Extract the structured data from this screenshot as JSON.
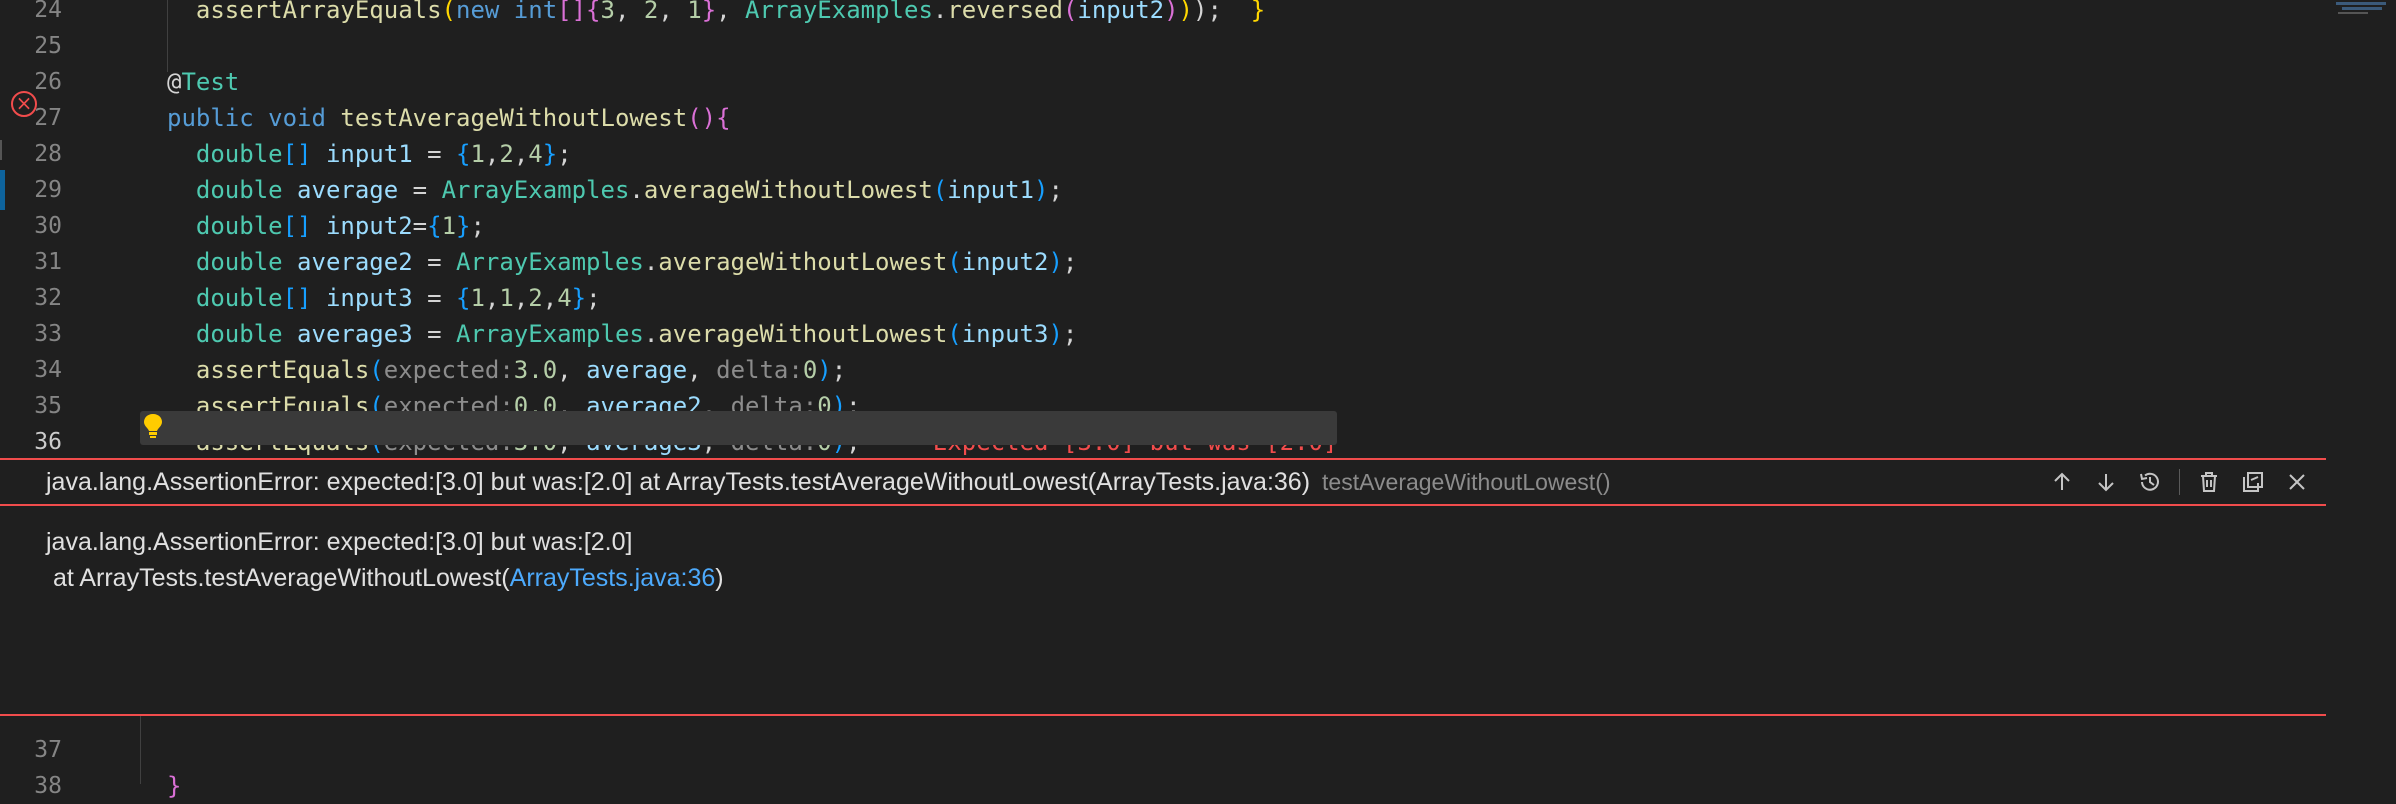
{
  "editor": {
    "lines": [
      {
        "num": "24",
        "tokens": [
          {
            "t": "  ",
            "c": "txt"
          },
          {
            "t": "assertArrayEquals",
            "c": "fn"
          },
          {
            "t": "(",
            "c": "p1"
          },
          {
            "t": "new ",
            "c": "kw"
          },
          {
            "t": "int",
            "c": "kw"
          },
          {
            "t": "[]{",
            "c": "p2"
          },
          {
            "t": "3",
            "c": "num"
          },
          {
            "t": ", ",
            "c": "txt"
          },
          {
            "t": "2",
            "c": "num"
          },
          {
            "t": ", ",
            "c": "txt"
          },
          {
            "t": "1",
            "c": "num"
          },
          {
            "t": "}",
            "c": "p2"
          },
          {
            "t": ", ",
            "c": "txt"
          },
          {
            "t": "ArrayExamples",
            "c": "typ"
          },
          {
            "t": ".",
            "c": "txt"
          },
          {
            "t": "reversed",
            "c": "fn"
          },
          {
            "t": "(",
            "c": "p2"
          },
          {
            "t": "input2",
            "c": "var"
          },
          {
            "t": ")",
            "c": "p2"
          },
          {
            "t": ")",
            "c": "p1"
          },
          {
            "t": ");  ",
            "c": "txt"
          },
          {
            "t": "}",
            "c": "p1"
          }
        ]
      },
      {
        "num": "25",
        "tokens": []
      },
      {
        "num": "26",
        "tokens": [
          {
            "t": "@",
            "c": "txt"
          },
          {
            "t": "Test",
            "c": "typ"
          }
        ]
      },
      {
        "num": "27",
        "tokens": [
          {
            "t": "public ",
            "c": "kw"
          },
          {
            "t": "void ",
            "c": "kw"
          },
          {
            "t": "testAverageWithoutLowest",
            "c": "fn"
          },
          {
            "t": "()",
            "c": "p2"
          },
          {
            "t": "{",
            "c": "p2"
          }
        ]
      },
      {
        "num": "28",
        "tokens": [
          {
            "t": "  double",
            "c": "typ"
          },
          {
            "t": "[] ",
            "c": "p3"
          },
          {
            "t": "input1",
            "c": "var"
          },
          {
            "t": " = ",
            "c": "txt"
          },
          {
            "t": "{",
            "c": "p3"
          },
          {
            "t": "1",
            "c": "num"
          },
          {
            "t": ",",
            "c": "txt"
          },
          {
            "t": "2",
            "c": "num"
          },
          {
            "t": ",",
            "c": "txt"
          },
          {
            "t": "4",
            "c": "num"
          },
          {
            "t": "}",
            "c": "p3"
          },
          {
            "t": ";",
            "c": "txt"
          }
        ]
      },
      {
        "num": "29",
        "tokens": [
          {
            "t": "  double ",
            "c": "typ"
          },
          {
            "t": "average",
            "c": "var"
          },
          {
            "t": " = ",
            "c": "txt"
          },
          {
            "t": "ArrayExamples",
            "c": "typ"
          },
          {
            "t": ".",
            "c": "txt"
          },
          {
            "t": "averageWithoutLowest",
            "c": "fn"
          },
          {
            "t": "(",
            "c": "p3"
          },
          {
            "t": "input1",
            "c": "var"
          },
          {
            "t": ")",
            "c": "p3"
          },
          {
            "t": ";",
            "c": "txt"
          }
        ]
      },
      {
        "num": "30",
        "tokens": [
          {
            "t": "  double",
            "c": "typ"
          },
          {
            "t": "[] ",
            "c": "p3"
          },
          {
            "t": "input2",
            "c": "var"
          },
          {
            "t": "=",
            "c": "txt"
          },
          {
            "t": "{",
            "c": "p3"
          },
          {
            "t": "1",
            "c": "num"
          },
          {
            "t": "}",
            "c": "p3"
          },
          {
            "t": ";",
            "c": "txt"
          }
        ]
      },
      {
        "num": "31",
        "tokens": [
          {
            "t": "  double ",
            "c": "typ"
          },
          {
            "t": "average2",
            "c": "var"
          },
          {
            "t": " = ",
            "c": "txt"
          },
          {
            "t": "ArrayExamples",
            "c": "typ"
          },
          {
            "t": ".",
            "c": "txt"
          },
          {
            "t": "averageWithoutLowest",
            "c": "fn"
          },
          {
            "t": "(",
            "c": "p3"
          },
          {
            "t": "input2",
            "c": "var"
          },
          {
            "t": ")",
            "c": "p3"
          },
          {
            "t": ";",
            "c": "txt"
          }
        ]
      },
      {
        "num": "32",
        "tokens": [
          {
            "t": "  double",
            "c": "typ"
          },
          {
            "t": "[] ",
            "c": "p3"
          },
          {
            "t": "input3",
            "c": "var"
          },
          {
            "t": " = ",
            "c": "txt"
          },
          {
            "t": "{",
            "c": "p3"
          },
          {
            "t": "1",
            "c": "num"
          },
          {
            "t": ",",
            "c": "txt"
          },
          {
            "t": "1",
            "c": "num"
          },
          {
            "t": ",",
            "c": "txt"
          },
          {
            "t": "2",
            "c": "num"
          },
          {
            "t": ",",
            "c": "txt"
          },
          {
            "t": "4",
            "c": "num"
          },
          {
            "t": "}",
            "c": "p3"
          },
          {
            "t": ";",
            "c": "txt"
          }
        ]
      },
      {
        "num": "33",
        "tokens": [
          {
            "t": "  double ",
            "c": "typ"
          },
          {
            "t": "average3",
            "c": "var"
          },
          {
            "t": " = ",
            "c": "txt"
          },
          {
            "t": "ArrayExamples",
            "c": "typ"
          },
          {
            "t": ".",
            "c": "txt"
          },
          {
            "t": "averageWithoutLowest",
            "c": "fn"
          },
          {
            "t": "(",
            "c": "p3"
          },
          {
            "t": "input3",
            "c": "var"
          },
          {
            "t": ")",
            "c": "p3"
          },
          {
            "t": ";",
            "c": "txt"
          }
        ]
      },
      {
        "num": "34",
        "tokens": [
          {
            "t": "  assertEquals",
            "c": "fn"
          },
          {
            "t": "(",
            "c": "p3"
          },
          {
            "t": "expected:",
            "c": "hint"
          },
          {
            "t": "3.0",
            "c": "num"
          },
          {
            "t": ", ",
            "c": "txt"
          },
          {
            "t": "average",
            "c": "var"
          },
          {
            "t": ", ",
            "c": "txt"
          },
          {
            "t": "delta:",
            "c": "hint"
          },
          {
            "t": "0",
            "c": "num"
          },
          {
            "t": ")",
            "c": "p3"
          },
          {
            "t": ";",
            "c": "txt"
          }
        ]
      },
      {
        "num": "35",
        "tokens": [
          {
            "t": "  assertEquals",
            "c": "fn"
          },
          {
            "t": "(",
            "c": "p3"
          },
          {
            "t": "expected:",
            "c": "hint"
          },
          {
            "t": "0.0",
            "c": "num"
          },
          {
            "t": ", ",
            "c": "txt"
          },
          {
            "t": "average2",
            "c": "var"
          },
          {
            "t": ", ",
            "c": "txt"
          },
          {
            "t": "delta:",
            "c": "hint"
          },
          {
            "t": "0",
            "c": "num"
          },
          {
            "t": ")",
            "c": "p3"
          },
          {
            "t": ";",
            "c": "txt"
          }
        ]
      },
      {
        "num": "36",
        "tokens": [
          {
            "t": "  assertEquals",
            "c": "fn"
          },
          {
            "t": "(",
            "c": "p3"
          },
          {
            "t": "expected:",
            "c": "hint"
          },
          {
            "t": "3.0",
            "c": "num"
          },
          {
            "t": ", ",
            "c": "txt"
          },
          {
            "t": "average3",
            "c": "var"
          },
          {
            "t": ", ",
            "c": "txt"
          },
          {
            "t": "delta:",
            "c": "hint"
          },
          {
            "t": "0",
            "c": "num"
          },
          {
            "t": ")",
            "c": "p3"
          },
          {
            "t": ";",
            "c": "txt"
          },
          {
            "t": " ··· ",
            "c": "dot"
          },
          {
            "t": "Expected [3.0] but was [2.0]",
            "c": "inline-err"
          }
        ]
      }
    ],
    "after_lines": [
      {
        "num": "37",
        "tokens": []
      },
      {
        "num": "38",
        "tokens": [
          {
            "t": "}",
            "c": "p2"
          }
        ]
      }
    ]
  },
  "peek": {
    "title": "java.lang.AssertionError: expected:[3.0] but was:[2.0] at ArrayTests.testAverageWithoutLowest(ArrayTests.java:36)",
    "subtitle": "testAverageWithoutLowest()",
    "message_line1": "java.lang.AssertionError: expected:[3.0] but was:[2.0]",
    "message_line2_prefix": " at ArrayTests.testAverageWithoutLowest(",
    "message_link": "ArrayTests.java:36",
    "message_line2_suffix": ")",
    "actions": [
      "arrow-up-icon",
      "arrow-down-icon",
      "history-icon",
      "trash-icon",
      "open-to-side-icon",
      "close-icon"
    ]
  },
  "colors": {
    "error": "#f14c4c",
    "link": "#4daafc",
    "background": "#1f1f1f"
  }
}
